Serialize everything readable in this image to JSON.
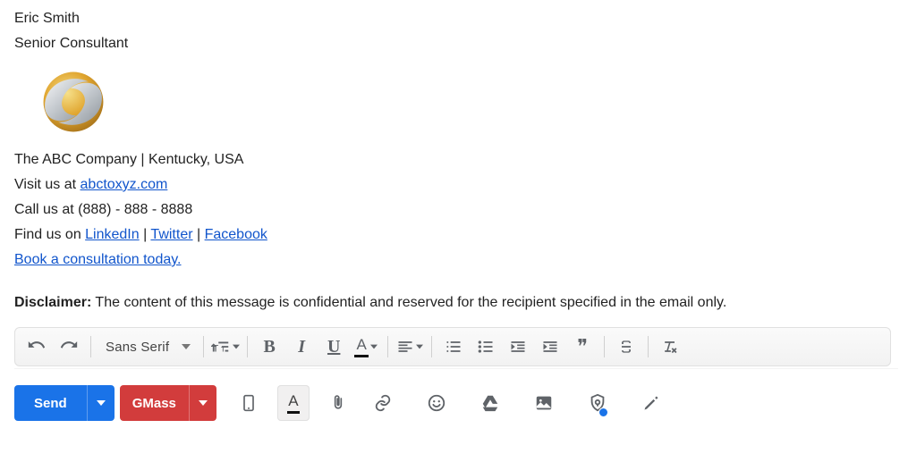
{
  "signature": {
    "name": "Eric Smith",
    "title": "Senior Consultant",
    "company_line": "The ABC Company | Kentucky, USA",
    "visit_prefix": "Visit us at ",
    "visit_link": "abctoxyz.com",
    "call_line": "Call us at (888) - 888 - 8888",
    "find_prefix": "Find us on ",
    "linkedin": "LinkedIn",
    "sep1": " | ",
    "twitter": "Twitter",
    "sep2": " | ",
    "facebook": "Facebook",
    "book_link": "Book a consultation today."
  },
  "disclaimer": {
    "label": "Disclaimer:",
    "text": " The content of this message is confidential and reserved for the recipient specified in the email only."
  },
  "format_toolbar": {
    "font": "Sans Serif",
    "bold": "B",
    "italic": "I",
    "underline": "U",
    "color_letter": "A",
    "quote": "❝❝"
  },
  "actions": {
    "send": "Send",
    "gmass": "GMass",
    "text_color_letter": "A"
  }
}
